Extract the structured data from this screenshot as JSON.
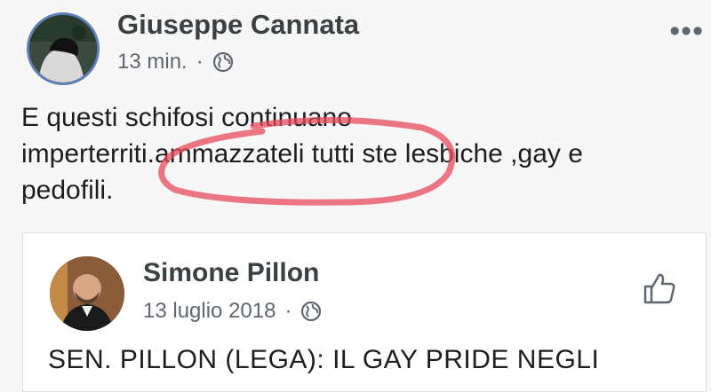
{
  "post": {
    "author": "Giuseppe Cannata",
    "time": "13 min.",
    "separator": "·",
    "privacy_icon": "globe-icon",
    "menu_icon": "more-options-icon",
    "text_line1": "E questi schifosi continuano",
    "text_line2": "imperterriti.ammazzateli tutti ste lesbiche ,gay e",
    "text_line3": "pedofili.",
    "highlight_color": "#e8495b"
  },
  "shared": {
    "author": "Simone Pillon",
    "date": "13 luglio 2018",
    "separator": "·",
    "privacy_icon": "globe-icon",
    "action_icon": "thumbs-up-icon",
    "headline": "SEN. PILLON (LEGA): IL GAY PRIDE NEGLI"
  }
}
